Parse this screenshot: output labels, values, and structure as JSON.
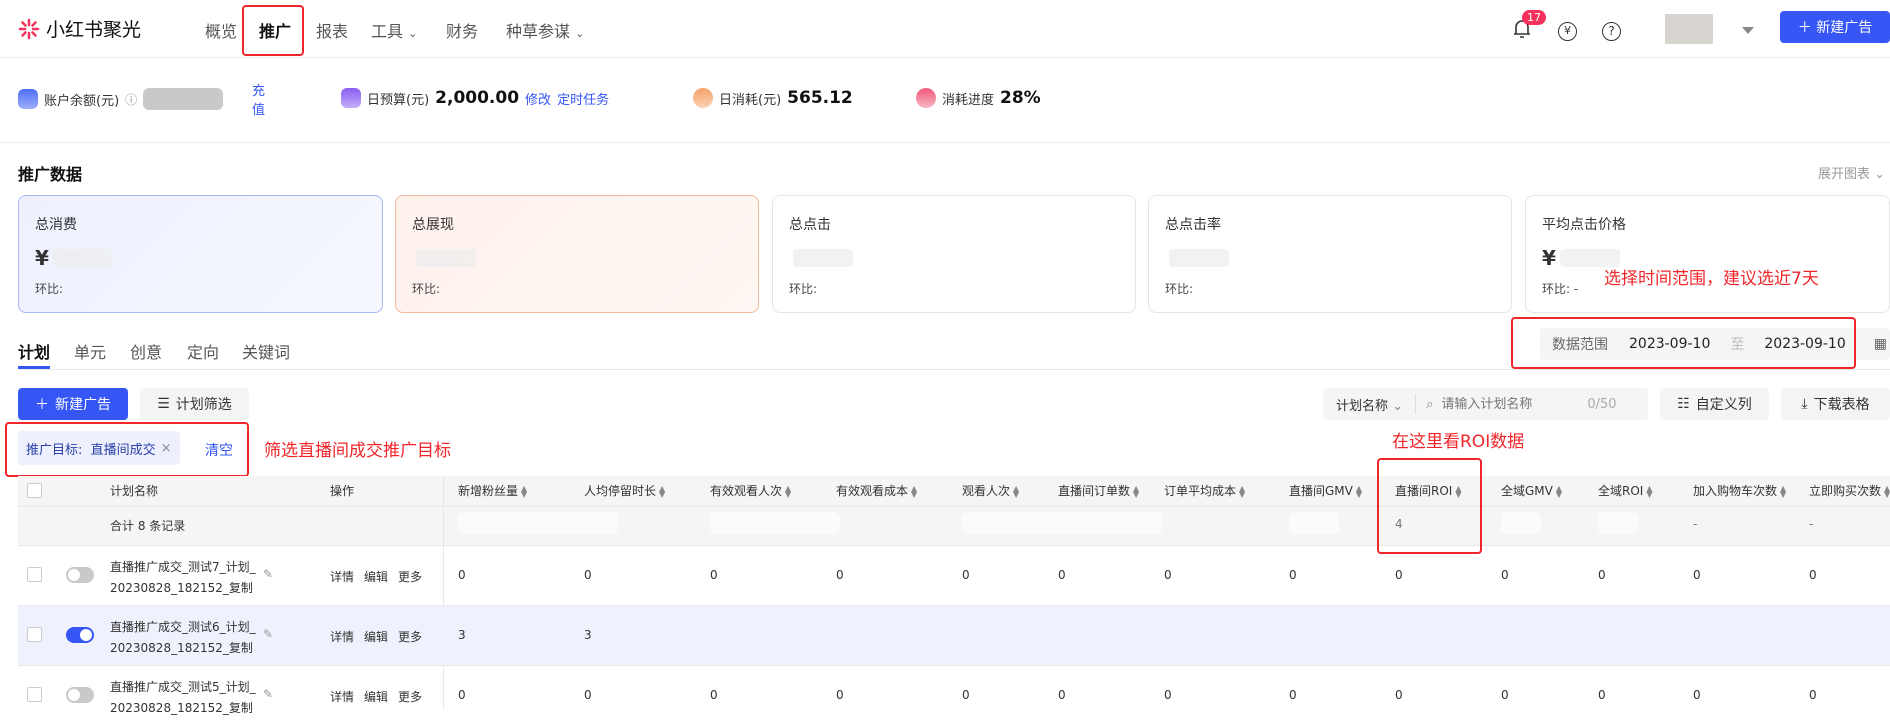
{
  "header": {
    "logo_text": "小红书聚光",
    "nav": [
      {
        "label": "概览"
      },
      {
        "label": "推广",
        "active": true
      },
      {
        "label": "报表"
      },
      {
        "label": "工具",
        "dropdown": true
      },
      {
        "label": "财务"
      },
      {
        "label": "种草参谋",
        "dropdown": true
      }
    ],
    "notification_count": "17",
    "new_ad_button": "＋ 新建广告",
    "icons": [
      "bell-icon",
      "yen-icon",
      "help-icon",
      "caret-down-icon"
    ]
  },
  "stats": {
    "balance_label": "账户余额(元)",
    "recharge": "充值",
    "budget_label": "日预算(元)",
    "budget_value": "2,000.00",
    "modify": "修改",
    "scheduled_task": "定时任务",
    "spend_label": "日消耗(元)",
    "spend_value": "565.12",
    "progress_label": "消耗进度",
    "progress_value": "28%"
  },
  "section": {
    "title": "推广数据",
    "expand_chart": "展开图表"
  },
  "cards": [
    {
      "title": "总消费",
      "prefix": "¥",
      "ratio": "环比:"
    },
    {
      "title": "总展现",
      "prefix": "",
      "ratio": "环比:"
    },
    {
      "title": "总点击",
      "prefix": "",
      "ratio": "环比:"
    },
    {
      "title": "总点击率",
      "prefix": "",
      "ratio": "环比:"
    },
    {
      "title": "平均点击价格",
      "prefix": "¥",
      "ratio": "环比: -"
    }
  ],
  "tabs": [
    "计划",
    "单元",
    "创意",
    "定向",
    "关键词"
  ],
  "date_range": {
    "label": "数据范围",
    "start": "2023-09-10",
    "sep": "至",
    "end": "2023-09-10"
  },
  "toolbar": {
    "new_ad": "新建广告",
    "plan_filter": "计划筛选",
    "search_field": "计划名称",
    "search_placeholder": "请输入计划名称",
    "search_count": "0/50",
    "custom_columns": "自定义列",
    "download": "下载表格"
  },
  "filter": {
    "tag": "推广目标:  直播间成交",
    "clear": "清空"
  },
  "annotations": {
    "date": "选择时间范围，建议选近7天",
    "filter": "筛选直播间成交推广目标",
    "roi": "在这里看ROI数据"
  },
  "table": {
    "columns": [
      "计划名称",
      "操作",
      "新增粉丝量",
      "人均停留时长",
      "有效观看人次",
      "有效观看成本",
      "观看人次",
      "直播间订单数",
      "订单平均成本",
      "直播间GMV",
      "直播间ROI",
      "全域GMV",
      "全域ROI",
      "加入购物车次数",
      "立即购买次数"
    ],
    "total_label": "合计 8 条记录",
    "total_values": [
      "",
      "",
      "",
      "",
      "",
      "",
      "",
      "",
      "4",
      "",
      "",
      "-",
      "-"
    ],
    "actions": [
      "详情",
      "编辑",
      "更多"
    ],
    "rows": [
      {
        "name": "直播推广成交_测试7_计划_20230828_182152_复制",
        "enabled": false,
        "values": [
          "0",
          "0",
          "0",
          "0",
          "0",
          "0",
          "0",
          "0",
          "0",
          "0",
          "0",
          "0",
          "0"
        ]
      },
      {
        "name": "直播推广成交_测试6_计划_20230828_182152_复制",
        "enabled": true,
        "values": [
          "3",
          "3",
          "",
          "",
          "",
          "",
          "",
          "",
          "",
          "",
          "",
          "",
          ""
        ]
      },
      {
        "name": "直播推广成交_测试5_计划_20230828_182152_复制",
        "enabled": false,
        "values": [
          "0",
          "0",
          "0",
          "0",
          "0",
          "0",
          "0",
          "0",
          "0",
          "0",
          "0",
          "0",
          "0"
        ]
      }
    ]
  },
  "colors": {
    "accent": "#3656f6",
    "annotation": "#f0262b",
    "badge": "#f5325c"
  }
}
